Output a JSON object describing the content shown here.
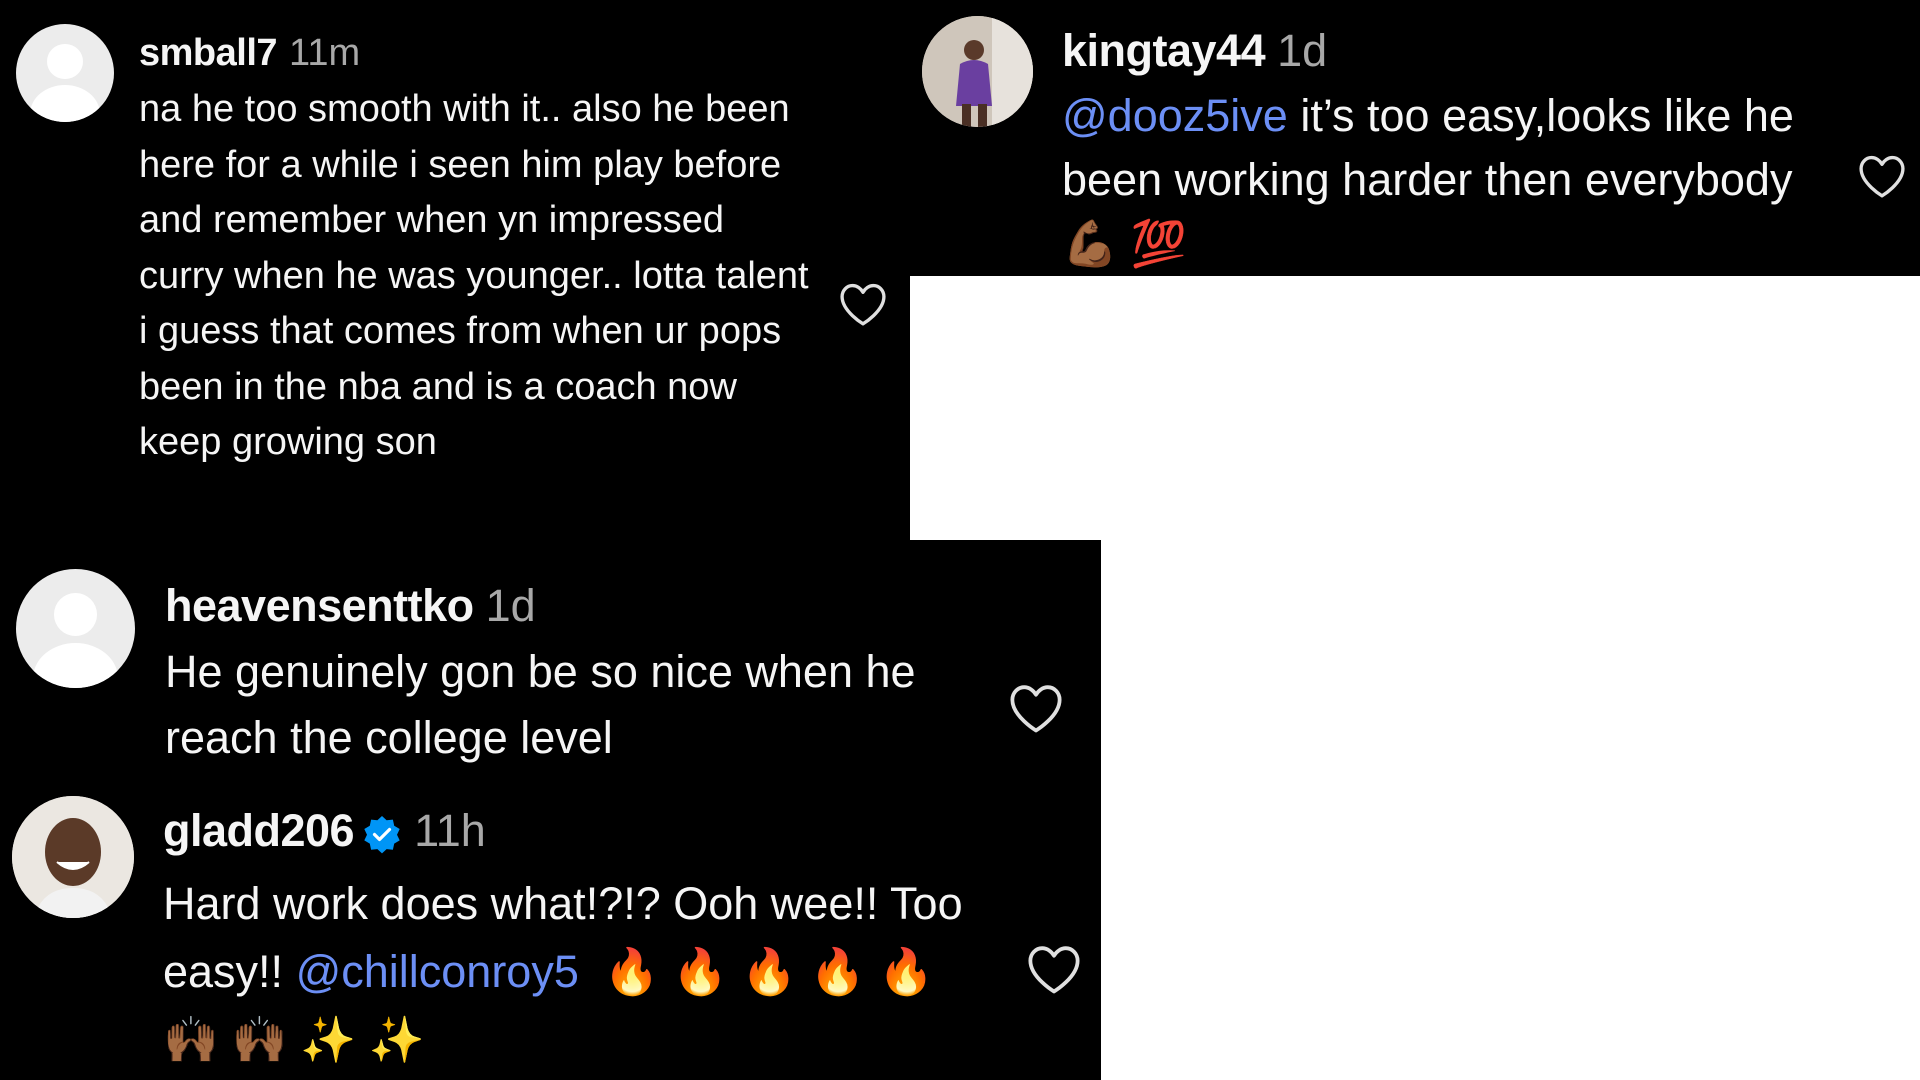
{
  "comments": {
    "smball7": {
      "username": "smball7",
      "time": "11m",
      "text": "na he too smooth with it.. also he been here for a while i seen him play before and remember when yn impressed curry when he was younger.. lotta talent i guess that comes from when ur pops been in the nba and is a coach now keep growing son"
    },
    "kingtay44": {
      "username": "kingtay44",
      "time": "1d",
      "mention": "@dooz5ive",
      "text": " it’s too easy,looks like he been working harder then everybody ",
      "emojis": [
        "💪🏾",
        "💯"
      ]
    },
    "heavensenttko": {
      "username": "heavensenttko",
      "time": "1d",
      "text": "He genuinely gon be so nice when he reach the college level"
    },
    "gladd206": {
      "username": "gladd206",
      "time": "11h",
      "text": "Hard work does what!?!? Ooh wee!! Too easy!! ",
      "mention": "@chillconroy5",
      "emojis": [
        "🔥",
        "🔥",
        "🔥",
        "🔥",
        "🔥",
        "🙌🏾",
        "🙌🏾",
        "✨",
        "✨"
      ]
    }
  },
  "colors": {
    "background": "#000000",
    "username": "#f5f5f5",
    "timestamp": "#a8a8a8",
    "mention": "#6c8ff5",
    "verified": "#0095f6"
  },
  "icons": [
    "heart-outline-icon",
    "verified-badge-icon",
    "default-avatar-icon"
  ]
}
